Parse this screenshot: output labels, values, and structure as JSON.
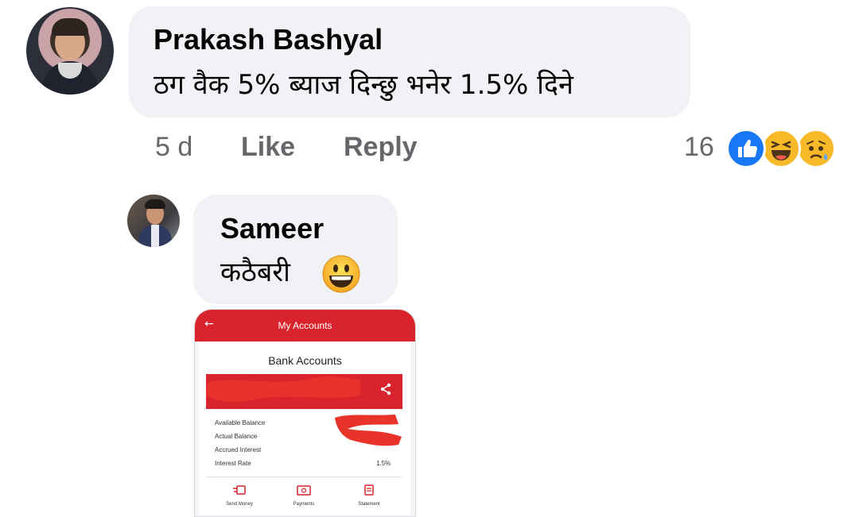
{
  "comment": {
    "author": "Prakash Bashyal",
    "text": "ठग वैक 5% ब्याज दिन्छु भनेर 1.5% दिने",
    "time": "5 d",
    "like_label": "Like",
    "reply_label": "Reply",
    "reaction_count": "16",
    "reactions": [
      "like-icon",
      "haha-icon",
      "sad-icon"
    ]
  },
  "reply": {
    "author": "Sameer",
    "text": "कठैबरी",
    "emoji": "grinning-face-icon",
    "attachment": {
      "header_title": "My Accounts",
      "card_title": "Bank Accounts",
      "rows": [
        "Available Balance",
        "Actual Balance",
        "Accrued Interest",
        "Interest Rate"
      ],
      "interest_rate_value": "1.5%",
      "actions": [
        "Send Money",
        "Payments",
        "Statement"
      ]
    }
  },
  "colors": {
    "bubble": "#f0f2f5",
    "meta_text": "#65676b",
    "like_blue": "#1877f2",
    "reaction_yellow": "#f7b928",
    "bank_red": "#d9232d"
  }
}
